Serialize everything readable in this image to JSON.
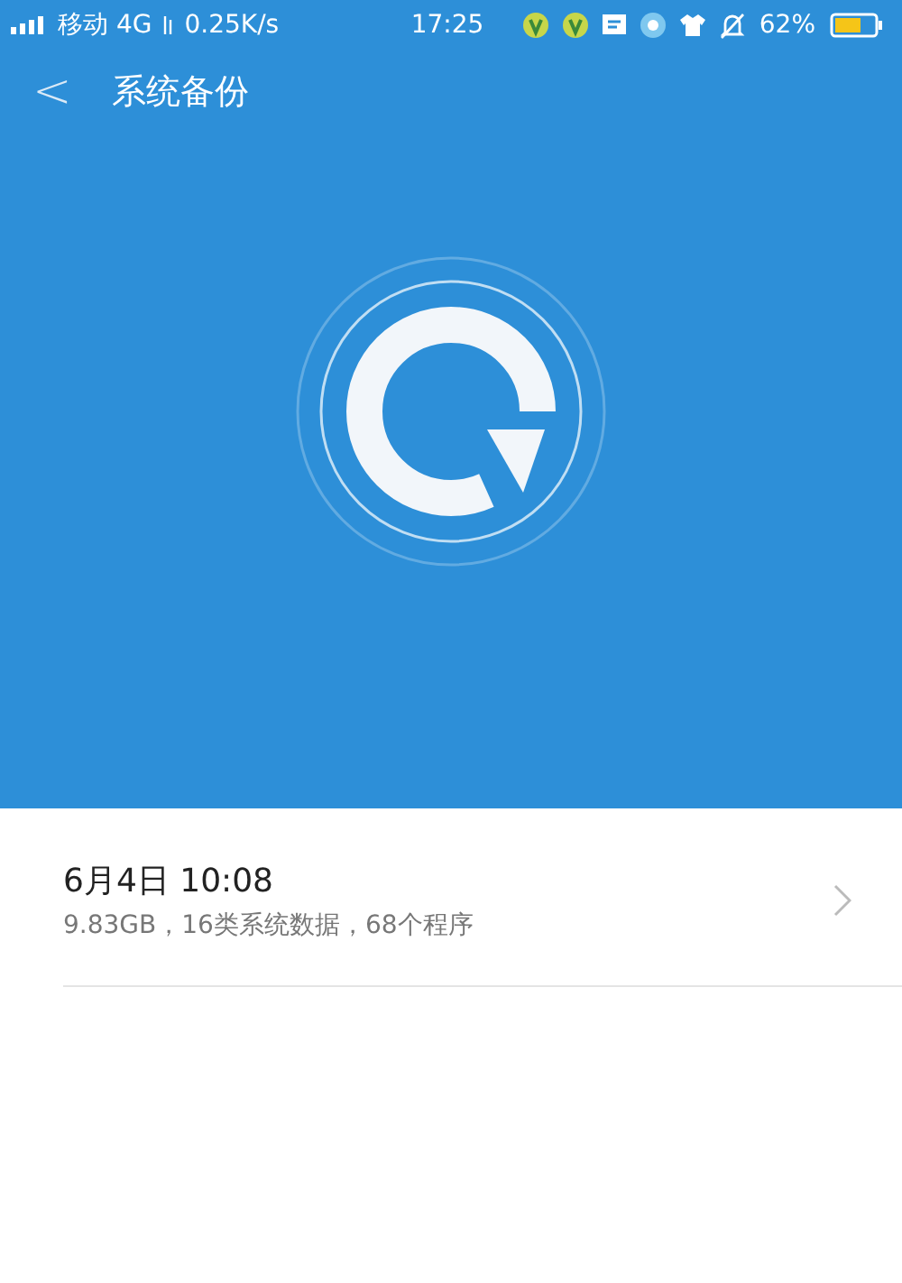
{
  "status_bar": {
    "carrier": "移动 4G",
    "speed": "0.25K/s",
    "time": "17:25",
    "battery": "62%"
  },
  "header": {
    "back": "<",
    "title": "系统备份"
  },
  "backups": [
    {
      "title": "6月4日 10:08",
      "details": "9.83GB，16类系统数据，68个程序"
    }
  ]
}
